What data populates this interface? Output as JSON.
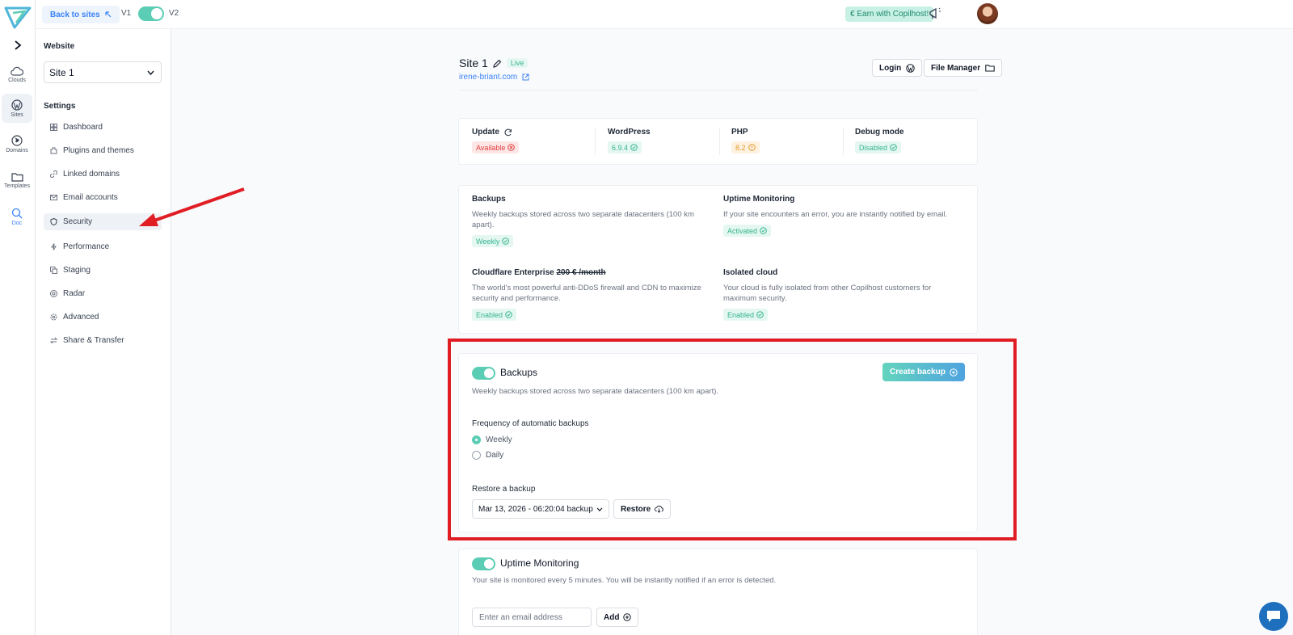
{
  "rail": {
    "items": [
      {
        "label": "Clouds",
        "icon": "cloud-icon"
      },
      {
        "label": "Sites",
        "icon": "wordpress-icon"
      },
      {
        "label": "Domains",
        "icon": "globe-icon"
      },
      {
        "label": "Templates",
        "icon": "folder-icon"
      },
      {
        "label": "Doc",
        "icon": "search-icon"
      }
    ]
  },
  "topbar": {
    "back_label": "Back to sites",
    "v1": "V1",
    "v2": "V2",
    "earn_label": "€ Earn with Copilhost!"
  },
  "sidebar": {
    "website_heading": "Website",
    "site_value": "Site 1",
    "settings_heading": "Settings",
    "items": [
      {
        "label": "Dashboard"
      },
      {
        "label": "Plugins and themes"
      },
      {
        "label": "Linked domains"
      },
      {
        "label": "Email accounts"
      },
      {
        "label": "Security"
      },
      {
        "label": "Performance"
      },
      {
        "label": "Staging"
      },
      {
        "label": "Radar"
      },
      {
        "label": "Advanced"
      },
      {
        "label": "Share & Transfer"
      }
    ],
    "active_item": "Security"
  },
  "site": {
    "name": "Site 1",
    "status": "Live",
    "url": "irene-briant.com",
    "login_label": "Login",
    "file_manager_label": "File Manager"
  },
  "stats": {
    "update": {
      "title": "Update",
      "value": "Available"
    },
    "wordpress": {
      "title": "WordPress",
      "value": "6.9.4"
    },
    "php": {
      "title": "PHP",
      "value": "8.2"
    },
    "debug": {
      "title": "Debug mode",
      "value": "Disabled"
    }
  },
  "features": {
    "backups": {
      "title": "Backups",
      "desc": "Weekly backups stored across two separate datacenters (100 km apart).",
      "badge": "Weekly"
    },
    "uptime": {
      "title": "Uptime Monitoring",
      "desc": "If your site encounters an error, you are instantly notified by email.",
      "badge": "Activated"
    },
    "cloudflare": {
      "title": "Cloudflare Enterprise",
      "price": "200 € /month",
      "desc": "The world's most powerful anti-DDoS firewall and CDN to maximize security and performance.",
      "badge": "Enabled"
    },
    "isolated": {
      "title": "Isolated cloud",
      "desc": "Your cloud is fully isolated from other Copilhost customers for maximum security.",
      "badge": "Enabled"
    }
  },
  "backups_section": {
    "title": "Backups",
    "desc": "Weekly backups stored across two separate datacenters (100 km apart).",
    "create_label": "Create backup",
    "frequency_label": "Frequency of automatic backups",
    "options": [
      "Weekly",
      "Daily"
    ],
    "selected": "Weekly",
    "restore_label": "Restore a backup",
    "restore_value": "Mar 13, 2026 - 06:20:04 backup",
    "restore_button": "Restore"
  },
  "uptime_section": {
    "title": "Uptime Monitoring",
    "desc": "Your site is monitored every 5 minutes. You will be instantly notified if an error is detected.",
    "email_placeholder": "Enter an email address",
    "add_label": "Add"
  },
  "colors": {
    "accent": "#5ccdb5",
    "link": "#3b82f6",
    "highlight": "#e11d24"
  }
}
